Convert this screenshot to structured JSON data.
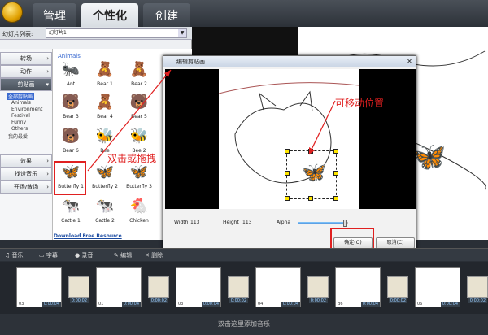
{
  "tabs": [
    "管理",
    "个性化",
    "创建"
  ],
  "slides": {
    "label": "幻灯片列表:",
    "selected": "幻灯片1"
  },
  "menu": {
    "items": [
      "转场",
      "动作",
      "剪贴画",
      "效果",
      "找设音乐",
      "开场/散场"
    ],
    "subitems": [
      "全部剪贴画",
      "Animals",
      "Environment",
      "Festival",
      "Funny",
      "Others",
      "我的最爱"
    ]
  },
  "clipart": {
    "section": "Animals",
    "items": [
      "Ant",
      "Bear 1",
      "Bear 2",
      "Bear 3",
      "Bear 4",
      "Bear 5",
      "Bear 6",
      "Bee",
      "Bee 2",
      "Butterfly 1",
      "Butterfly 2",
      "Butterfly 3",
      "Cattle 1",
      "Cattle 2",
      "Chicken"
    ],
    "download": "Download Free Resource"
  },
  "dialog": {
    "title": "编辑剪贴画",
    "width_label": "Width",
    "width": "113",
    "height_label": "Height",
    "height": "113",
    "alpha_label": "Alpha",
    "alpha": 0.95,
    "ok": "确定(O)",
    "cancel": "取消(C)"
  },
  "annotations": {
    "move": "可移动位置",
    "drag": "双击或拖拽"
  },
  "toolbar": {
    "music": "音乐",
    "subtitle": "字幕",
    "record": "录音",
    "edit": "编辑",
    "delete": "删除"
  },
  "timeline": {
    "thumbs": [
      {
        "num": "03",
        "dur": "0:00:04"
      },
      {
        "num": "01",
        "dur": "0:00:04"
      },
      {
        "num": "03",
        "dur": "0:00:04"
      },
      {
        "num": "04",
        "dur": "0:00:04"
      },
      {
        "num": "B6",
        "dur": "0:00:04"
      },
      {
        "num": "06",
        "dur": "0:00:04"
      }
    ],
    "trans_dur": "0:00:02",
    "music_hint": "双击这里添加音乐"
  }
}
